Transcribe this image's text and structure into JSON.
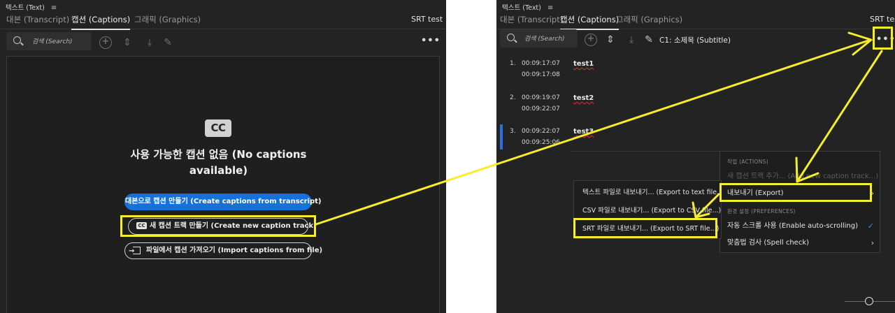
{
  "left_panel": {
    "title": "텍스트 (Text)",
    "menu_glyph": "≡",
    "tabs": [
      {
        "label": "대본 (Transcript)",
        "active": false
      },
      {
        "label": "캡션 (Captions)",
        "active": true
      },
      {
        "label": "그래픽 (Graphics)",
        "active": false
      }
    ],
    "project": "SRT test",
    "search_placeholder": "검색 (Search)",
    "more_glyph": "•••",
    "cc_badge": "CC",
    "empty_title": "사용 가능한 캡션 없음 (No captions available)",
    "btn_create_from_transcript": "대본으로 캡션 만들기 (Create captions from transcript)",
    "btn_new_caption_track": "새 캡션 트랙 만들기 (Create new caption track)",
    "btn_new_caption_track_icon": "CC",
    "btn_import_captions": "파일에서 캡션 가져오기 (Import captions from file)"
  },
  "right_panel": {
    "title": "텍스트 (Text)",
    "menu_glyph": "≡",
    "tabs": [
      {
        "label": "대본 (Transcript)",
        "active": false
      },
      {
        "label": "캡션 (Captions)",
        "active": true
      },
      {
        "label": "그래픽 (Graphics)",
        "active": false
      }
    ],
    "project": "SRT test",
    "search_placeholder": "검색 (Search)",
    "track_label": "C1: 소제목 (Subtitle)",
    "more_glyph": "•••",
    "captions": [
      {
        "num": "1.",
        "in": "00:09:17:07",
        "out": "00:09:17:08",
        "text": "test1",
        "selected": false
      },
      {
        "num": "2.",
        "in": "00:09:19:07",
        "out": "00:09:22:07",
        "text": "test2",
        "selected": false
      },
      {
        "num": "3.",
        "in": "00:09:22:07",
        "out": "00:09:25:06",
        "text": "test3",
        "selected": true
      }
    ],
    "menu": {
      "actions_header": "작업 (ACTIONS)",
      "add_new_track": "새 캡션 트랙 추가... (Add new caption track...)",
      "export": "내보내기 (Export)",
      "preferences_header": "환경 설정 (PREFERENCES)",
      "auto_scroll": "자동 스크롤 사용 (Enable auto-scrolling)",
      "spell_check": "맞춤법 검사 (Spell check)",
      "chevron": "›",
      "check": "✓"
    },
    "export_submenu": [
      "텍스트 파일로 내보내기... (Export to text file...)",
      "CSV 파일로 내보내기... (Export to CSV file...)",
      "SRT 파일로 내보내기... (Export to SRT file...)"
    ]
  },
  "colors": {
    "highlight": "#f6ee2c",
    "primary_button": "#1672d9",
    "panel_bg": "#232323",
    "selection_marker": "#2d6fe0"
  },
  "icons": [
    "search-icon",
    "add-icon",
    "expand-icon",
    "collapse-icon",
    "pencil-icon",
    "more-icon",
    "cc-icon",
    "import-icon",
    "chevron-right-icon",
    "check-icon"
  ]
}
